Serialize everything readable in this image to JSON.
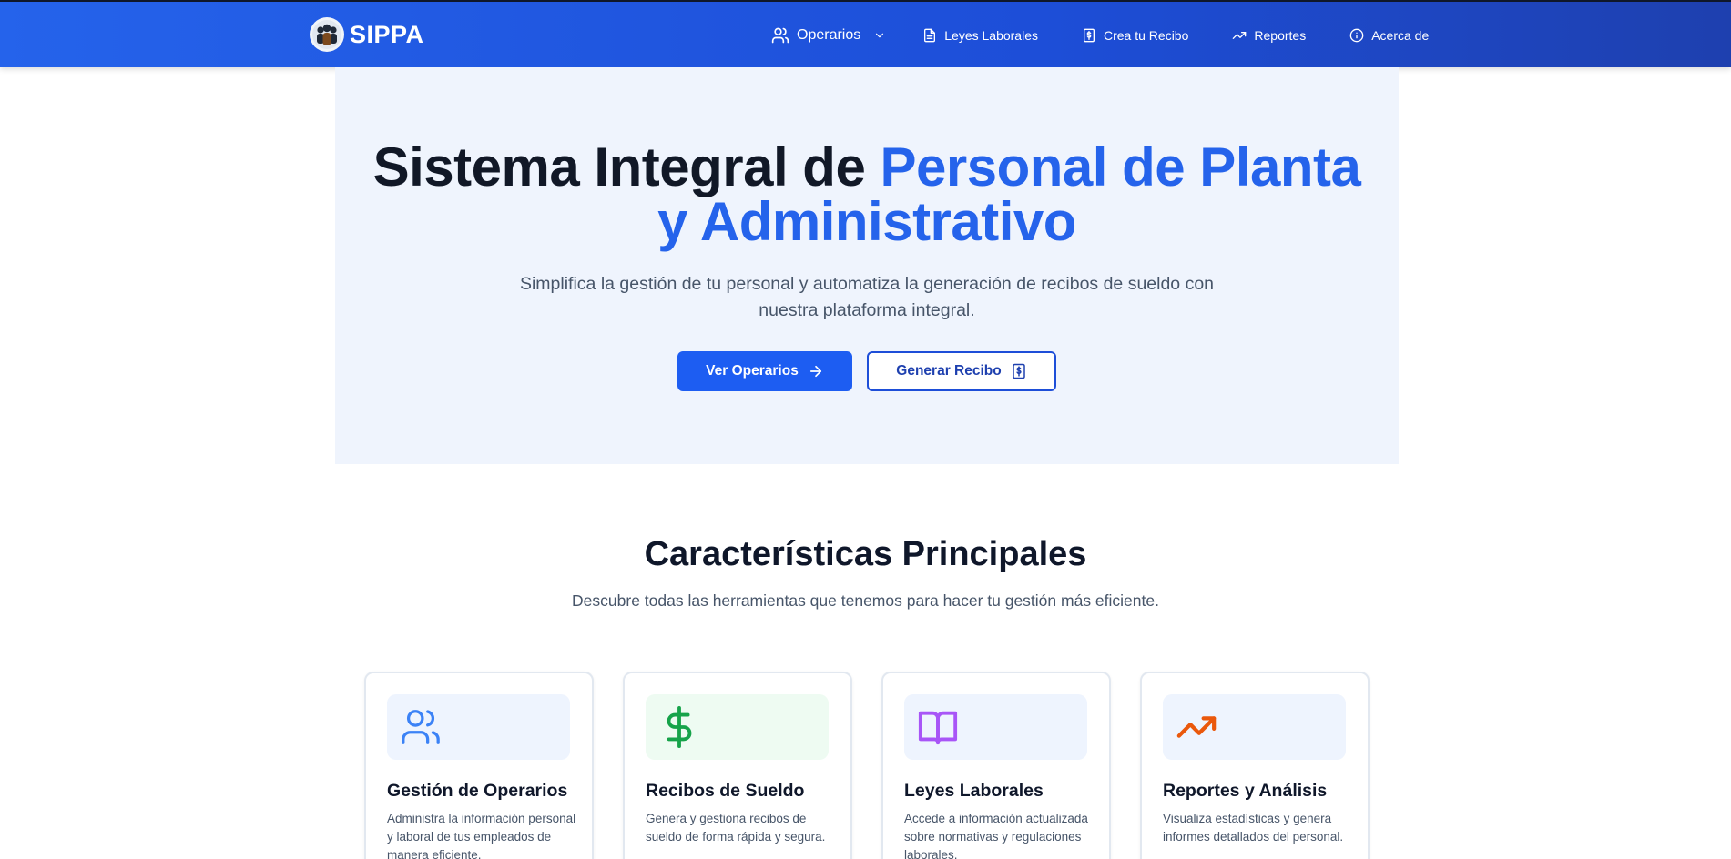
{
  "navbar": {
    "brand": "SIPPA",
    "items": [
      {
        "label": "Operarios",
        "icon": "users-icon",
        "has_dropdown": true
      },
      {
        "label": "Leyes Laborales",
        "icon": "document-icon"
      },
      {
        "label": "Crea tu Recibo",
        "icon": "receipt-icon"
      },
      {
        "label": "Reportes",
        "icon": "trending-up-icon"
      },
      {
        "label": "Acerca de",
        "icon": "info-icon"
      }
    ]
  },
  "hero": {
    "title_part1": "Sistema Integral de ",
    "title_part2": "Personal de Planta",
    "title_part3": "y Administrativo",
    "subtitle": "Simplifica la gestión de tu personal y automatiza la generación de recibos de sueldo con nuestra plataforma integral.",
    "primary_button": "Ver Operarios",
    "secondary_button": "Generar Recibo"
  },
  "features": {
    "title": "Características Principales",
    "subtitle": "Descubre todas las herramientas que tenemos para hacer tu gestión más eficiente.",
    "cards": [
      {
        "title": "Gestión de Operarios",
        "description": "Administra la información personal y laboral de tus empleados de manera eficiente.",
        "icon": "users-icon",
        "color": "#3b82f6",
        "bg": "#eef4fe"
      },
      {
        "title": "Recibos de Sueldo",
        "description": "Genera y gestiona recibos de sueldo de forma rápida y segura.",
        "icon": "dollar-icon",
        "color": "#16a34a",
        "bg": "#eefbf2"
      },
      {
        "title": "Leyes Laborales",
        "description": "Accede a información actualizada sobre normativas y regulaciones laborales.",
        "icon": "book-icon",
        "color": "#a855f7",
        "bg": "#eef4fe"
      },
      {
        "title": "Reportes y Análisis",
        "description": "Visualiza estadísticas y genera informes detallados del personal.",
        "icon": "trending-up-icon",
        "color": "#ea580c",
        "bg": "#eef4fe"
      }
    ]
  },
  "colors": {
    "primary": "#2563eb",
    "hero_bg": "#eff4fd",
    "text_dark": "#0f172a",
    "text_muted": "#475569"
  }
}
